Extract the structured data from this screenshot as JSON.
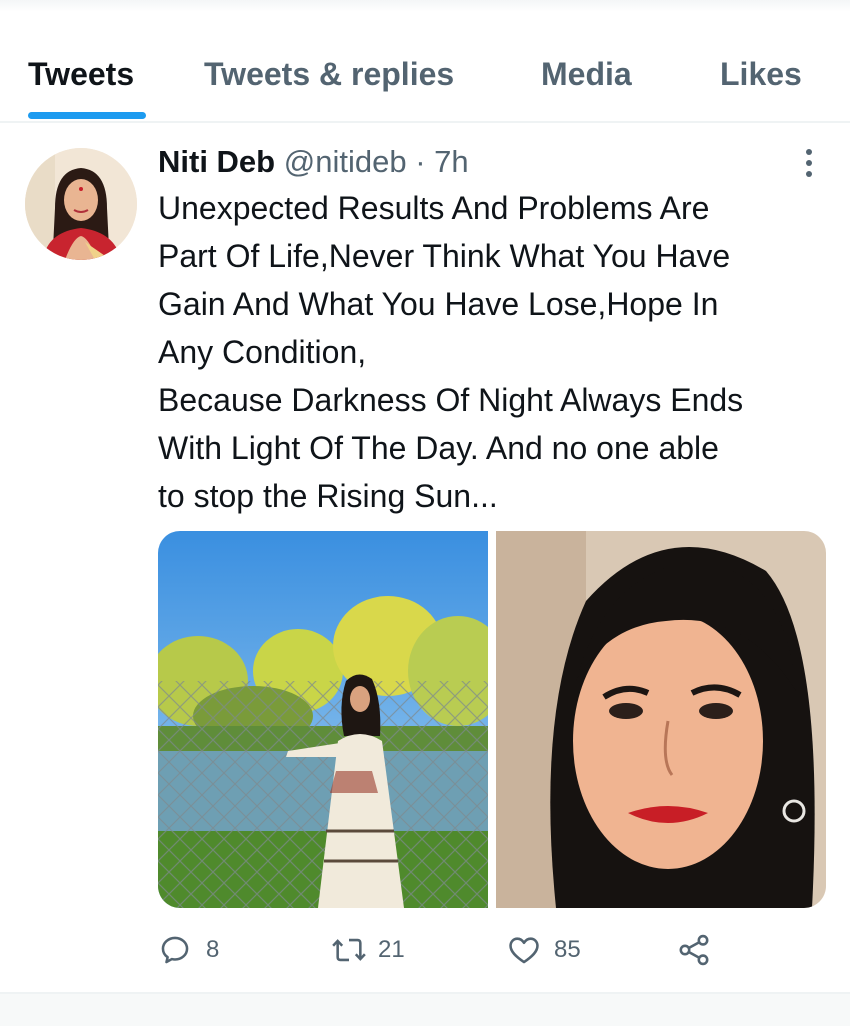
{
  "tabs": [
    {
      "label": "Tweets",
      "active": true
    },
    {
      "label": "Tweets & replies",
      "active": false
    },
    {
      "label": "Media",
      "active": false
    },
    {
      "label": "Likes",
      "active": false
    }
  ],
  "tweet": {
    "name": "Niti Deb",
    "handle": "@nitideb",
    "separator": "·",
    "time": "7h",
    "text_lines": [
      "Unexpected Results And Problems Are",
      "Part Of Life,Never Think What You Have",
      "Gain And What You Have Lose,Hope In",
      "Any Condition,",
      "Because Darkness Of Night Always Ends",
      "With Light Of The Day. And no one able",
      "to stop the Rising Sun..."
    ],
    "actions": {
      "replies": "8",
      "retweets": "21",
      "likes": "85"
    }
  },
  "colors": {
    "accent": "#1d9bf0",
    "text_primary": "#0f1419",
    "text_secondary": "#536471",
    "divider": "#eff3f4"
  },
  "icons": [
    "more-vertical-icon",
    "reply-icon",
    "retweet-icon",
    "like-icon",
    "share-icon"
  ]
}
